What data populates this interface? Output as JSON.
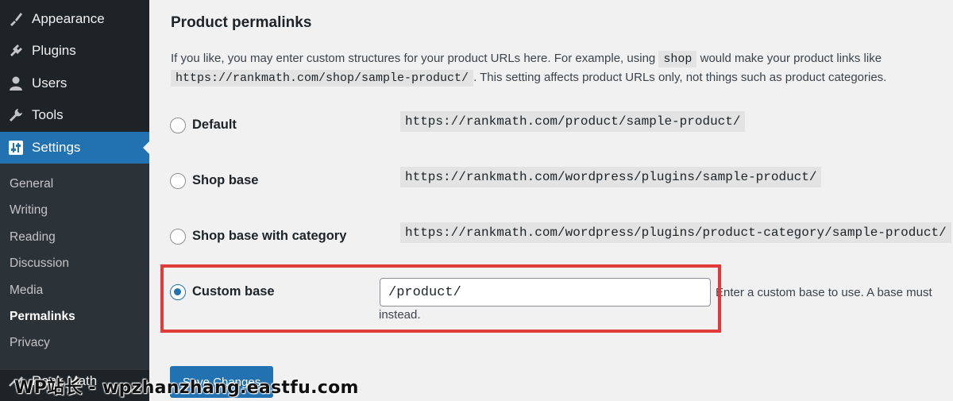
{
  "sidebar": {
    "menu": [
      {
        "label": "Appearance",
        "icon": "paintbrush-icon"
      },
      {
        "label": "Plugins",
        "icon": "plug-icon"
      },
      {
        "label": "Users",
        "icon": "user-icon"
      },
      {
        "label": "Tools",
        "icon": "wrench-icon"
      },
      {
        "label": "Settings",
        "icon": "settings-sliders-icon"
      }
    ],
    "submenu": [
      "General",
      "Writing",
      "Reading",
      "Discussion",
      "Media",
      "Permalinks",
      "Privacy"
    ],
    "partial_item": {
      "label": "Rank Math",
      "icon": "rank-math-icon"
    },
    "active_color": "#2271b1"
  },
  "main": {
    "title": "Product permalinks",
    "description": {
      "before": "If you like, you may enter custom structures for your product URLs here. For example, using ",
      "code1": "shop",
      "middle": " would make your product links like ",
      "code2": "https://rankmath.com/shop/sample-product/",
      "after": ". This setting affects product URLs only, not things such as product categories."
    },
    "options": [
      {
        "label": "Default",
        "example": "https://rankmath.com/product/sample-product/",
        "checked": false
      },
      {
        "label": "Shop base",
        "example": "https://rankmath.com/wordpress/plugins/sample-product/",
        "checked": false
      },
      {
        "label": "Shop base with category",
        "example": "https://rankmath.com/wordpress/plugins/product-category/sample-product/",
        "checked": false
      },
      {
        "label": "Custom base",
        "checked": true
      }
    ],
    "custom_base": {
      "value": "/product/",
      "help_line1": "Enter a custom base to use. A base must",
      "help_line2": "instead."
    },
    "save_label": "Save Changes",
    "highlight_color": "#e03a3a"
  },
  "watermark": "WP站长 - wpzhanzhang.eastfu.com"
}
